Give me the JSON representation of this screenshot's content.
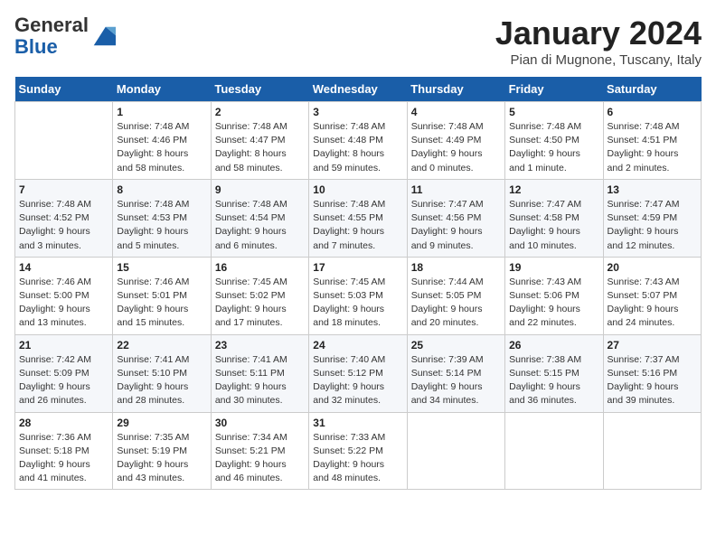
{
  "logo": {
    "general": "General",
    "blue": "Blue"
  },
  "header": {
    "month_title": "January 2024",
    "subtitle": "Pian di Mugnone, Tuscany, Italy"
  },
  "days_of_week": [
    "Sunday",
    "Monday",
    "Tuesday",
    "Wednesday",
    "Thursday",
    "Friday",
    "Saturday"
  ],
  "weeks": [
    [
      {
        "day": "",
        "info": ""
      },
      {
        "day": "1",
        "info": "Sunrise: 7:48 AM\nSunset: 4:46 PM\nDaylight: 8 hours\nand 58 minutes."
      },
      {
        "day": "2",
        "info": "Sunrise: 7:48 AM\nSunset: 4:47 PM\nDaylight: 8 hours\nand 58 minutes."
      },
      {
        "day": "3",
        "info": "Sunrise: 7:48 AM\nSunset: 4:48 PM\nDaylight: 8 hours\nand 59 minutes."
      },
      {
        "day": "4",
        "info": "Sunrise: 7:48 AM\nSunset: 4:49 PM\nDaylight: 9 hours\nand 0 minutes."
      },
      {
        "day": "5",
        "info": "Sunrise: 7:48 AM\nSunset: 4:50 PM\nDaylight: 9 hours\nand 1 minute."
      },
      {
        "day": "6",
        "info": "Sunrise: 7:48 AM\nSunset: 4:51 PM\nDaylight: 9 hours\nand 2 minutes."
      }
    ],
    [
      {
        "day": "7",
        "info": "Sunrise: 7:48 AM\nSunset: 4:52 PM\nDaylight: 9 hours\nand 3 minutes."
      },
      {
        "day": "8",
        "info": "Sunrise: 7:48 AM\nSunset: 4:53 PM\nDaylight: 9 hours\nand 5 minutes."
      },
      {
        "day": "9",
        "info": "Sunrise: 7:48 AM\nSunset: 4:54 PM\nDaylight: 9 hours\nand 6 minutes."
      },
      {
        "day": "10",
        "info": "Sunrise: 7:48 AM\nSunset: 4:55 PM\nDaylight: 9 hours\nand 7 minutes."
      },
      {
        "day": "11",
        "info": "Sunrise: 7:47 AM\nSunset: 4:56 PM\nDaylight: 9 hours\nand 9 minutes."
      },
      {
        "day": "12",
        "info": "Sunrise: 7:47 AM\nSunset: 4:58 PM\nDaylight: 9 hours\nand 10 minutes."
      },
      {
        "day": "13",
        "info": "Sunrise: 7:47 AM\nSunset: 4:59 PM\nDaylight: 9 hours\nand 12 minutes."
      }
    ],
    [
      {
        "day": "14",
        "info": "Sunrise: 7:46 AM\nSunset: 5:00 PM\nDaylight: 9 hours\nand 13 minutes."
      },
      {
        "day": "15",
        "info": "Sunrise: 7:46 AM\nSunset: 5:01 PM\nDaylight: 9 hours\nand 15 minutes."
      },
      {
        "day": "16",
        "info": "Sunrise: 7:45 AM\nSunset: 5:02 PM\nDaylight: 9 hours\nand 17 minutes."
      },
      {
        "day": "17",
        "info": "Sunrise: 7:45 AM\nSunset: 5:03 PM\nDaylight: 9 hours\nand 18 minutes."
      },
      {
        "day": "18",
        "info": "Sunrise: 7:44 AM\nSunset: 5:05 PM\nDaylight: 9 hours\nand 20 minutes."
      },
      {
        "day": "19",
        "info": "Sunrise: 7:43 AM\nSunset: 5:06 PM\nDaylight: 9 hours\nand 22 minutes."
      },
      {
        "day": "20",
        "info": "Sunrise: 7:43 AM\nSunset: 5:07 PM\nDaylight: 9 hours\nand 24 minutes."
      }
    ],
    [
      {
        "day": "21",
        "info": "Sunrise: 7:42 AM\nSunset: 5:09 PM\nDaylight: 9 hours\nand 26 minutes."
      },
      {
        "day": "22",
        "info": "Sunrise: 7:41 AM\nSunset: 5:10 PM\nDaylight: 9 hours\nand 28 minutes."
      },
      {
        "day": "23",
        "info": "Sunrise: 7:41 AM\nSunset: 5:11 PM\nDaylight: 9 hours\nand 30 minutes."
      },
      {
        "day": "24",
        "info": "Sunrise: 7:40 AM\nSunset: 5:12 PM\nDaylight: 9 hours\nand 32 minutes."
      },
      {
        "day": "25",
        "info": "Sunrise: 7:39 AM\nSunset: 5:14 PM\nDaylight: 9 hours\nand 34 minutes."
      },
      {
        "day": "26",
        "info": "Sunrise: 7:38 AM\nSunset: 5:15 PM\nDaylight: 9 hours\nand 36 minutes."
      },
      {
        "day": "27",
        "info": "Sunrise: 7:37 AM\nSunset: 5:16 PM\nDaylight: 9 hours\nand 39 minutes."
      }
    ],
    [
      {
        "day": "28",
        "info": "Sunrise: 7:36 AM\nSunset: 5:18 PM\nDaylight: 9 hours\nand 41 minutes."
      },
      {
        "day": "29",
        "info": "Sunrise: 7:35 AM\nSunset: 5:19 PM\nDaylight: 9 hours\nand 43 minutes."
      },
      {
        "day": "30",
        "info": "Sunrise: 7:34 AM\nSunset: 5:21 PM\nDaylight: 9 hours\nand 46 minutes."
      },
      {
        "day": "31",
        "info": "Sunrise: 7:33 AM\nSunset: 5:22 PM\nDaylight: 9 hours\nand 48 minutes."
      },
      {
        "day": "",
        "info": ""
      },
      {
        "day": "",
        "info": ""
      },
      {
        "day": "",
        "info": ""
      }
    ]
  ]
}
